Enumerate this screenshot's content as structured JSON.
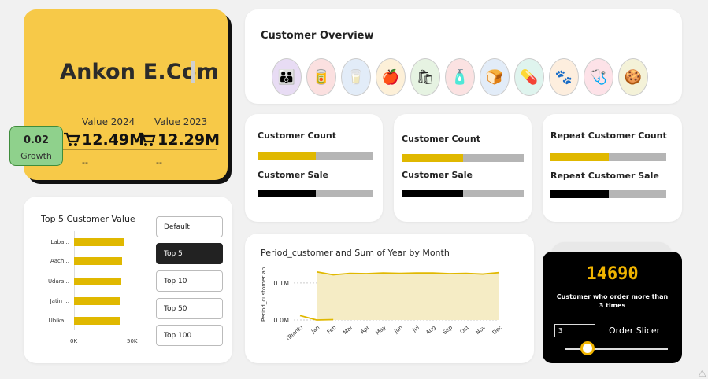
{
  "hero": {
    "title": "Ankon E.Com",
    "value_2024_label": "Value 2024",
    "value_2023_label": "Value 2023",
    "value_2024": "12.49M",
    "value_2023": "12.29M",
    "dash_2024": "--",
    "dash_2023": "--"
  },
  "growth": {
    "value": "0.02",
    "label": "Growth"
  },
  "overview": {
    "title": "Customer Overview"
  },
  "metrics": [
    {
      "label1": "Customer Count",
      "label2": "Customer Sale",
      "fill1": 0.5,
      "fill2": 0.5
    },
    {
      "label1": "Customer Count",
      "label2": "Customer Sale",
      "fill1": 0.5,
      "fill2": 0.5
    },
    {
      "label1": "Repeat Customer Count",
      "label2": "Repeat Customer Sale",
      "fill1": 0.5,
      "fill2": 0.5
    }
  ],
  "top5": {
    "title": "Top 5 Customer Value",
    "rows": [
      {
        "label": "Laba...",
        "value": 0.88
      },
      {
        "label": "Aach...",
        "value": 0.84
      },
      {
        "label": "Udars...",
        "value": 0.82
      },
      {
        "label": "Jatin ...",
        "value": 0.81
      },
      {
        "label": "Ubika...",
        "value": 0.79
      }
    ],
    "x_ticks": [
      "0K",
      "50K"
    ],
    "buttons": [
      "Default",
      "Top 5",
      "Top 10",
      "Top 50",
      "Top 100"
    ],
    "selected": "Top 5"
  },
  "period_chart": {
    "title": "Period_customer and Sum of Year by Month",
    "ylabel": "Period_customer an...",
    "y_ticks": [
      "0.1M",
      "0.0M"
    ]
  },
  "chart_data": {
    "type": "line",
    "title": "Period_customer and Sum of Year by Month",
    "categories": [
      "(Blank)",
      "Jan",
      "Feb",
      "Mar",
      "Apr",
      "May",
      "Jun",
      "Jul",
      "Aug",
      "Sep",
      "Oct",
      "Nov",
      "Dec"
    ],
    "series": [
      {
        "values": [
          null,
          0.13,
          0.122,
          0.126,
          0.125,
          0.127,
          0.126,
          0.127,
          0.127,
          0.125,
          0.126,
          0.124,
          0.128
        ]
      },
      {
        "values": [
          0.012,
          0.0,
          0.001,
          null,
          null,
          null,
          null,
          null,
          null,
          null,
          null,
          null,
          null
        ]
      }
    ],
    "ylim": [
      0,
      0.14
    ],
    "colors": {
      "line": "#e0b800",
      "area": "#f5ecc5"
    }
  },
  "kpi": {
    "value": "14690",
    "caption": "Customer who order more than 3 times",
    "slicer_label": "Order Slicer",
    "slicer_value": "3",
    "slider_fraction": 0.22
  },
  "icons": [
    "family-icon",
    "groceries-icon",
    "milk-icon",
    "fruits-icon",
    "produce-bag-icon",
    "cleaning-icon",
    "bakery-icon",
    "pharmacy-icon",
    "pet-icon",
    "medicine-icon",
    "snacks-icon"
  ],
  "colors": {
    "brand": "#f7c948",
    "accent": "#e0b800",
    "dark": "#000000"
  }
}
